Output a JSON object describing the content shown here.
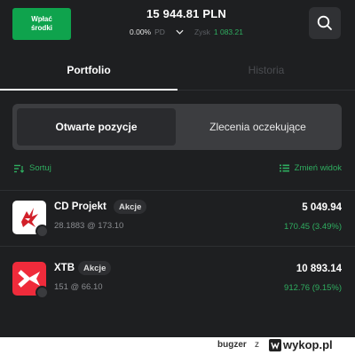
{
  "header": {
    "deposit_label": "Wpłać\nśrodki",
    "balance": "15 944.81 PLN",
    "percent": "0.00%",
    "pd_label": "PD",
    "profit_label": "Zysk",
    "profit_value": "1 083.21"
  },
  "tabs": [
    {
      "label": "Portfolio",
      "active": true
    },
    {
      "label": "Historia",
      "active": false
    }
  ],
  "segment": {
    "open_positions": "Otwarte pozycje",
    "pending_orders": "Zlecenia oczekujące"
  },
  "tools": {
    "sort_label": "Sortuj",
    "view_label": "Zmień widok"
  },
  "positions": [
    {
      "name": "CD Projekt",
      "badge": "Akcje",
      "quantity": "28.1883 @ 173.10",
      "value": "5 049.94",
      "pnl": "170.45 (3.49%)"
    },
    {
      "name": "XTB",
      "badge": "Akcje",
      "quantity": "151 @ 66.10",
      "value": "10 893.14",
      "pnl": "912.76 (9.15%)"
    }
  ],
  "footer": {
    "user": "bugzer",
    "z": "z",
    "site": "wykop.pl"
  },
  "colors": {
    "green": "#0fa34d",
    "gain": "#2fae60",
    "background": "#1e1f21",
    "xtb_red": "#ef2b3b"
  }
}
